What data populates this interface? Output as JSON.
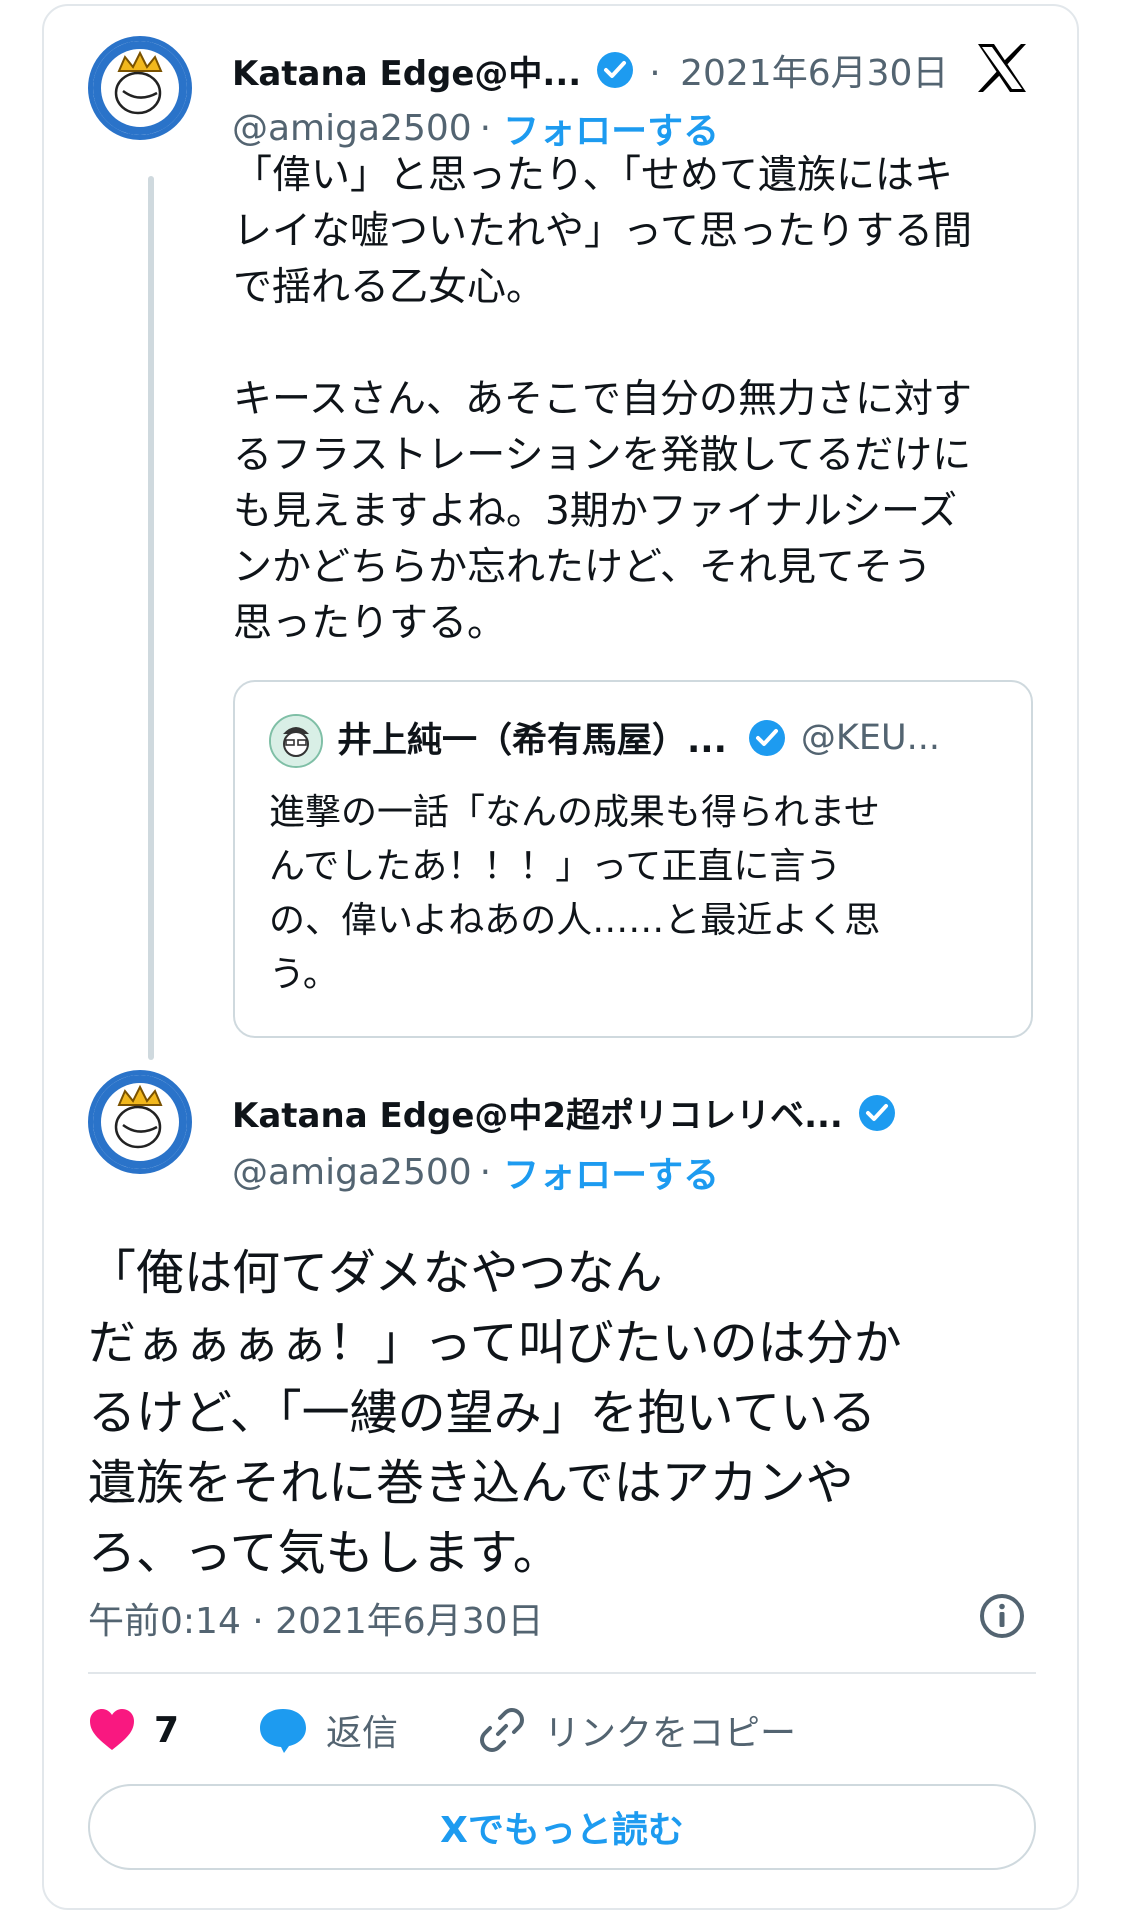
{
  "colors": {
    "link": "#1d9bf0",
    "muted": "#536471",
    "verified": "#1d9bf0",
    "like": "#f91880",
    "text": "#0f1419"
  },
  "tweet1": {
    "name": "Katana Edge@中...",
    "dot": "·",
    "date": "2021年6月30日",
    "handle": "@amiga2500",
    "follow": "フォローする",
    "text": "「偉い」と思ったり、「せめて遺族にはキ\nレイな嘘ついたれや」って思ったりする間\nで揺れる乙女心。\n\nキースさん、あそこで自分の無力さに対す\nるフラストレーションを発散してるだけに\nも見えますよね。3期かファイナルシーズ\nンかどちらか忘れたけど、それ見てそう\n思ったりする。"
  },
  "quote": {
    "name": "井上純一（希有馬屋）...",
    "handle": "@KEU...",
    "text": "進撃の一話「なんの成果も得られませ\nんでしたあ！！！」って正直に言う\nの、偉いよねあの人……と最近よく思\nう。"
  },
  "tweet2": {
    "name": "Katana Edge@中2超ポリコレリベ...",
    "handle": "@amiga2500",
    "dot": "·",
    "follow": "フォローする",
    "text": "「俺は何てダメなやつなん\nだぁぁぁぁ！」って叫びたいのは分か\nるけど、「一縷の望み」を抱いている\n遺族をそれに巻き込んではアカンや\nろ、って気もします。",
    "timestamp": "午前0:14 · 2021年6月30日"
  },
  "actions": {
    "likes": "7",
    "reply": "返信",
    "copy_link": "リンクをコピー"
  },
  "more_button": "Xでもっと読む",
  "icons": [
    "x-logo-icon",
    "verified-icon",
    "info-icon",
    "heart-icon",
    "reply-icon",
    "link-icon"
  ]
}
